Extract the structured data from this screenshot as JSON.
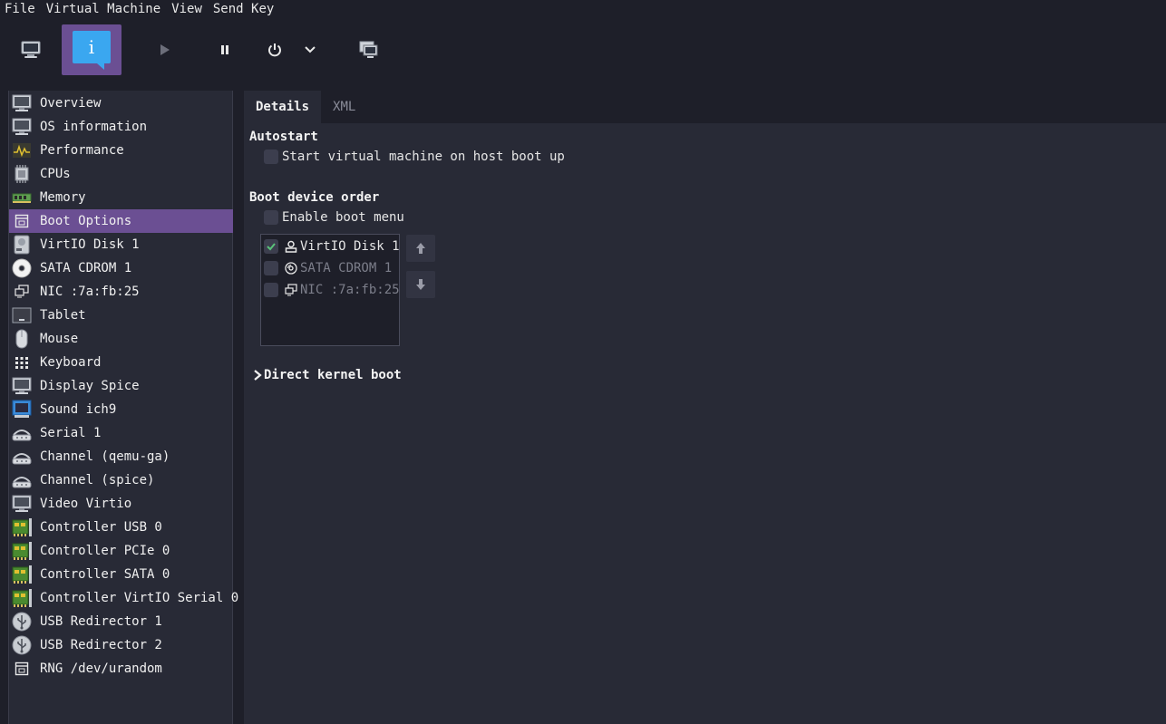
{
  "menu": [
    "File",
    "Virtual Machine",
    "View",
    "Send Key"
  ],
  "toolbar": {
    "buttons": [
      {
        "name": "console-button",
        "icon": "monitor-icon"
      },
      {
        "name": "details-button",
        "icon": "info-icon",
        "active": true
      },
      {
        "name": "run-button",
        "icon": "play-icon"
      },
      {
        "name": "pause-button",
        "icon": "pause-icon"
      },
      {
        "name": "shutdown-button",
        "icon": "power-icon"
      },
      {
        "name": "shutdown-menu-button",
        "icon": "chevron-down-icon"
      },
      {
        "name": "snapshots-button",
        "icon": "snapshot-icon"
      }
    ]
  },
  "sidebar": {
    "items": [
      {
        "label": "Overview",
        "icon": "monitor-icon"
      },
      {
        "label": "OS information",
        "icon": "monitor-icon"
      },
      {
        "label": "Performance",
        "icon": "performance-icon"
      },
      {
        "label": "CPUs",
        "icon": "cpu-icon"
      },
      {
        "label": "Memory",
        "icon": "memory-icon"
      },
      {
        "label": "Boot Options",
        "icon": "boot-icon",
        "selected": true
      },
      {
        "label": "VirtIO Disk 1",
        "icon": "disk-icon"
      },
      {
        "label": "SATA CDROM 1",
        "icon": "cdrom-icon"
      },
      {
        "label": "NIC :7a:fb:25",
        "icon": "nic-icon"
      },
      {
        "label": "Tablet",
        "icon": "tablet-icon"
      },
      {
        "label": "Mouse",
        "icon": "mouse-icon"
      },
      {
        "label": "Keyboard",
        "icon": "keyboard-icon"
      },
      {
        "label": "Display Spice",
        "icon": "monitor-icon"
      },
      {
        "label": "Sound ich9",
        "icon": "sound-icon"
      },
      {
        "label": "Serial 1",
        "icon": "serial-icon"
      },
      {
        "label": "Channel (qemu-ga)",
        "icon": "serial-icon"
      },
      {
        "label": "Channel (spice)",
        "icon": "serial-icon"
      },
      {
        "label": "Video Virtio",
        "icon": "monitor-icon"
      },
      {
        "label": "Controller USB 0",
        "icon": "controller-icon"
      },
      {
        "label": "Controller PCIe 0",
        "icon": "controller-icon"
      },
      {
        "label": "Controller SATA 0",
        "icon": "controller-icon"
      },
      {
        "label": "Controller VirtIO Serial 0",
        "icon": "controller-icon"
      },
      {
        "label": "USB Redirector 1",
        "icon": "usb-icon"
      },
      {
        "label": "USB Redirector 2",
        "icon": "usb-icon"
      },
      {
        "label": "RNG /dev/urandom",
        "icon": "boot-icon"
      }
    ]
  },
  "tabs": [
    "Details",
    "XML"
  ],
  "autostart": {
    "title": "Autostart",
    "checkbox_label": "Start virtual machine on host boot up",
    "checked": false
  },
  "boot": {
    "title": "Boot device order",
    "enable_menu_label": "Enable boot menu",
    "enable_menu_checked": false,
    "devices": [
      {
        "label": "VirtIO Disk 1",
        "checked": true,
        "icon": "disk-icon"
      },
      {
        "label": "SATA CDROM 1",
        "checked": false,
        "icon": "cdrom-icon"
      },
      {
        "label": "NIC :7a:fb:25",
        "checked": false,
        "icon": "nic-icon"
      }
    ]
  },
  "direct_kernel": {
    "label": "Direct kernel boot"
  },
  "colors": {
    "accent": "#6b4f93",
    "info_blue": "#3aa7f0",
    "check_green": "#5ac37a"
  }
}
